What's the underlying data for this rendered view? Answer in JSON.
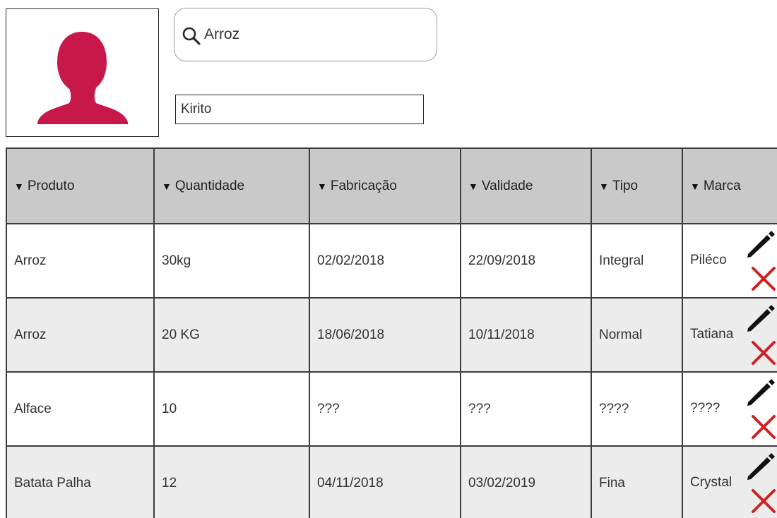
{
  "search": {
    "value": "Arroz",
    "icon": "search-icon"
  },
  "user": {
    "name": "Kirito",
    "avatar_color": "#c8184a"
  },
  "table": {
    "columns": [
      "Produto",
      "Quantidade",
      "Fabricação",
      "Validade",
      "Tipo",
      "Marca"
    ],
    "sort_indicator": "▼",
    "rows": [
      [
        "Arroz",
        "30kg",
        "02/02/2018",
        "22/09/2018",
        "Integral",
        "Piléco"
      ],
      [
        "Arroz",
        "20 KG",
        "18/06/2018",
        "10/11/2018",
        "Normal",
        "Tatiana"
      ],
      [
        "Alface",
        "10",
        "???",
        "???",
        "????",
        "????"
      ],
      [
        "Batata Palha",
        "12",
        "04/11/2018",
        "03/02/2019",
        "Fina",
        "Crystal"
      ]
    ],
    "row_actions": {
      "edit_icon": "pencil-icon",
      "delete_icon": "close-icon",
      "delete_color": "#cc2222"
    }
  },
  "colors": {
    "header_bg": "#c9c9c9",
    "row_alt_bg": "#ececec",
    "border": "#3c3c3c"
  }
}
